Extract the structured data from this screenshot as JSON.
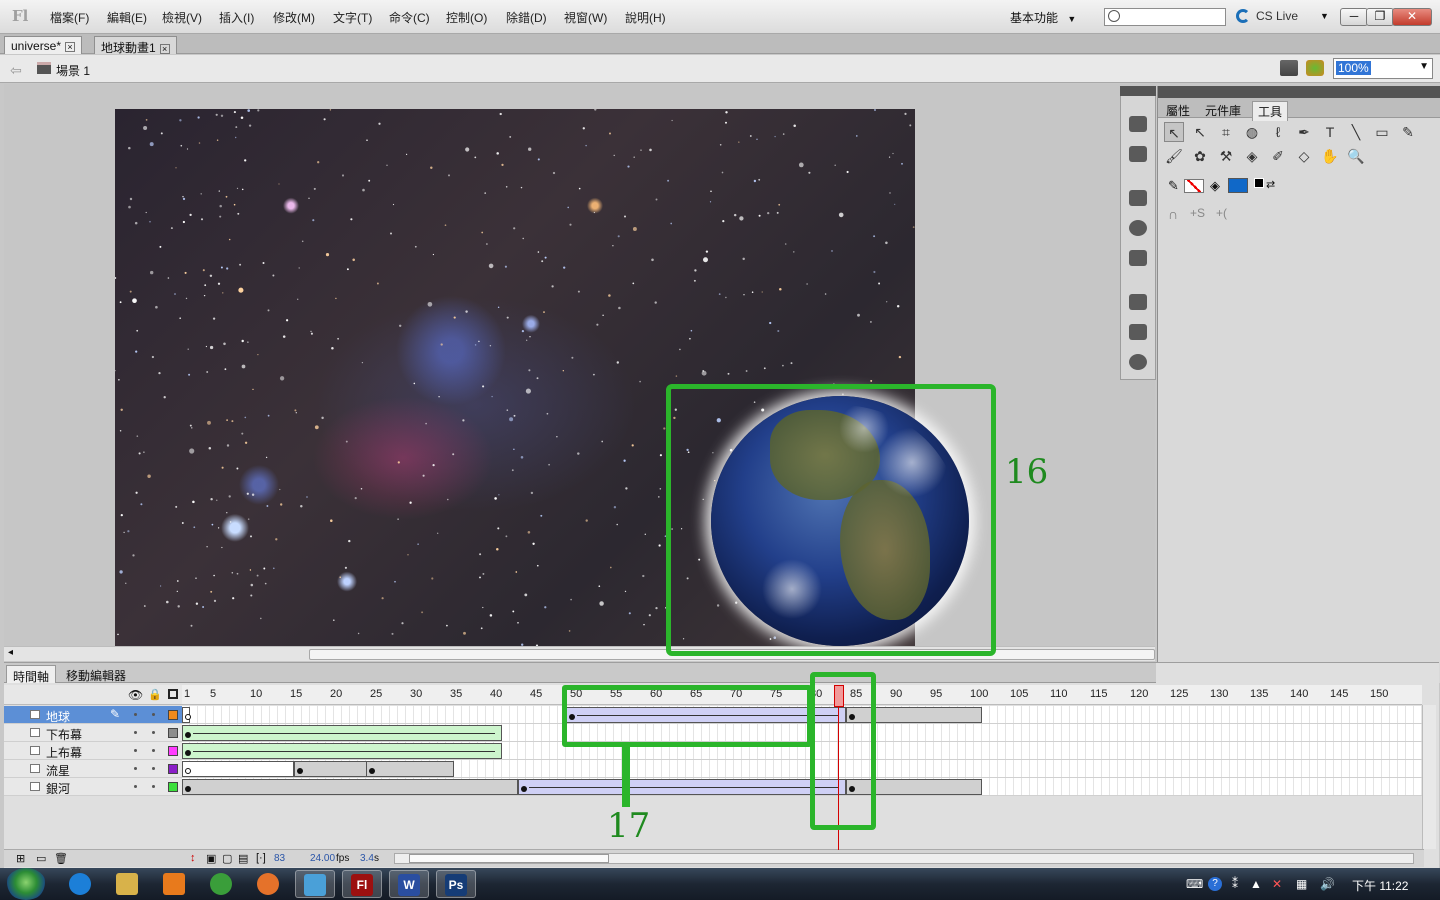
{
  "app": {
    "logo": "Fl"
  },
  "menu": [
    "檔案(F)",
    "編輯(E)",
    "檢視(V)",
    "插入(I)",
    "修改(M)",
    "文字(T)",
    "命令(C)",
    "控制(O)",
    "除錯(D)",
    "視窗(W)",
    "說明(H)"
  ],
  "workspace": {
    "label": "基本功能"
  },
  "cslive": {
    "label": "CS Live"
  },
  "window_controls": {
    "minimize": "─",
    "restore": "❐",
    "close": "✕"
  },
  "doc_tabs": [
    {
      "label": "universe*"
    },
    {
      "label": "地球動畫1"
    }
  ],
  "editbar": {
    "scene": "場景 1",
    "zoom": "100%"
  },
  "annotations": {
    "label_16": "16",
    "label_17": "17"
  },
  "panel": {
    "tabs": [
      "屬性",
      "元件庫",
      "工具"
    ]
  },
  "tools": [
    {
      "name": "selection-tool",
      "glyph": "↖"
    },
    {
      "name": "subselection-tool",
      "glyph": "↖"
    },
    {
      "name": "free-transform-tool",
      "glyph": "⌗"
    },
    {
      "name": "3d-rotation-tool",
      "glyph": "◍"
    },
    {
      "name": "lasso-tool",
      "glyph": "ℓ"
    },
    {
      "name": "pen-tool",
      "glyph": "✒"
    },
    {
      "name": "text-tool",
      "glyph": "T"
    },
    {
      "name": "line-tool",
      "glyph": "╲"
    },
    {
      "name": "rectangle-tool",
      "glyph": "▭"
    },
    {
      "name": "pencil-tool",
      "glyph": "✎"
    },
    {
      "name": "brush-tool",
      "glyph": "🖌"
    },
    {
      "name": "deco-tool",
      "glyph": "✿"
    },
    {
      "name": "bone-tool",
      "glyph": "⚒"
    },
    {
      "name": "paint-bucket-tool",
      "glyph": "◈"
    },
    {
      "name": "eyedropper-tool",
      "glyph": "✐"
    },
    {
      "name": "eraser-tool",
      "glyph": "◇"
    },
    {
      "name": "hand-tool",
      "glyph": "✋"
    },
    {
      "name": "zoom-tool",
      "glyph": "🔍"
    }
  ],
  "timeline": {
    "tabs": [
      "時間軸",
      "移動編輯器"
    ],
    "ruler": [
      "1",
      "5",
      "10",
      "15",
      "20",
      "25",
      "30",
      "35",
      "40",
      "45",
      "50",
      "55",
      "60",
      "65",
      "70",
      "75",
      "80",
      "85",
      "90",
      "95",
      "100",
      "105",
      "110",
      "115",
      "120",
      "125",
      "130",
      "135",
      "140",
      "145",
      "150"
    ],
    "layers": [
      {
        "name": "地球",
        "color": "#f08a1c",
        "selected": true
      },
      {
        "name": "下布幕",
        "color": "#8c8c8c",
        "selected": false
      },
      {
        "name": "上布幕",
        "color": "#ff3cff",
        "selected": false
      },
      {
        "name": "流星",
        "color": "#8a1fc8",
        "selected": false
      },
      {
        "name": "銀河",
        "color": "#3cdf3c",
        "selected": false
      }
    ],
    "footer": {
      "frame": "83",
      "fps": "24.00",
      "fps_unit": "fps",
      "time": "3.4",
      "time_unit": "s"
    }
  },
  "taskbar": {
    "clock": "下午 11:22",
    "apps": [
      "ie",
      "explorer",
      "media",
      "chrome",
      "firefox",
      "app",
      "flash",
      "word",
      "photoshop"
    ],
    "app_labels": {
      "flash": "Fl",
      "word": "W",
      "photoshop": "Ps"
    }
  }
}
